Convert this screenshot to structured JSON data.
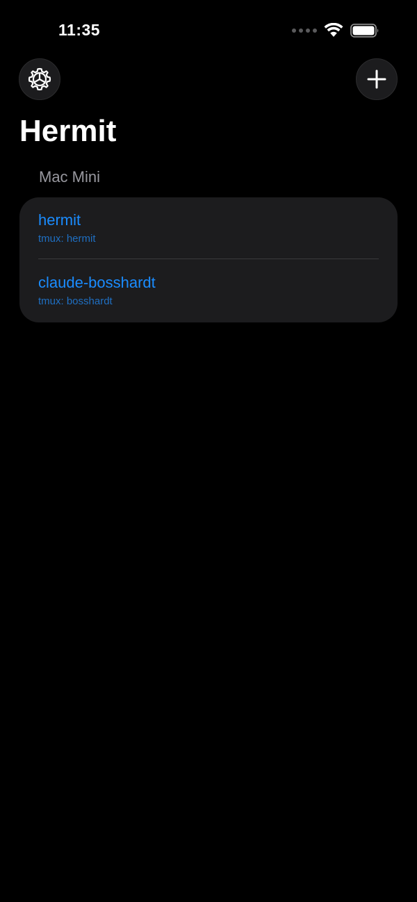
{
  "status_bar": {
    "time": "11:35"
  },
  "header": {
    "settings_icon": "gear-icon",
    "add_icon": "plus-icon",
    "title": "Hermit"
  },
  "sections": [
    {
      "header": "Mac Mini",
      "items": [
        {
          "title": "hermit",
          "subtitle": "tmux: hermit"
        },
        {
          "title": "claude-bosshardt",
          "subtitle": "tmux: bosshardt"
        }
      ]
    }
  ],
  "colors": {
    "background": "#000000",
    "card": "#1c1c1e",
    "accent": "#1a8cff",
    "secondary_text": "#98989f"
  }
}
